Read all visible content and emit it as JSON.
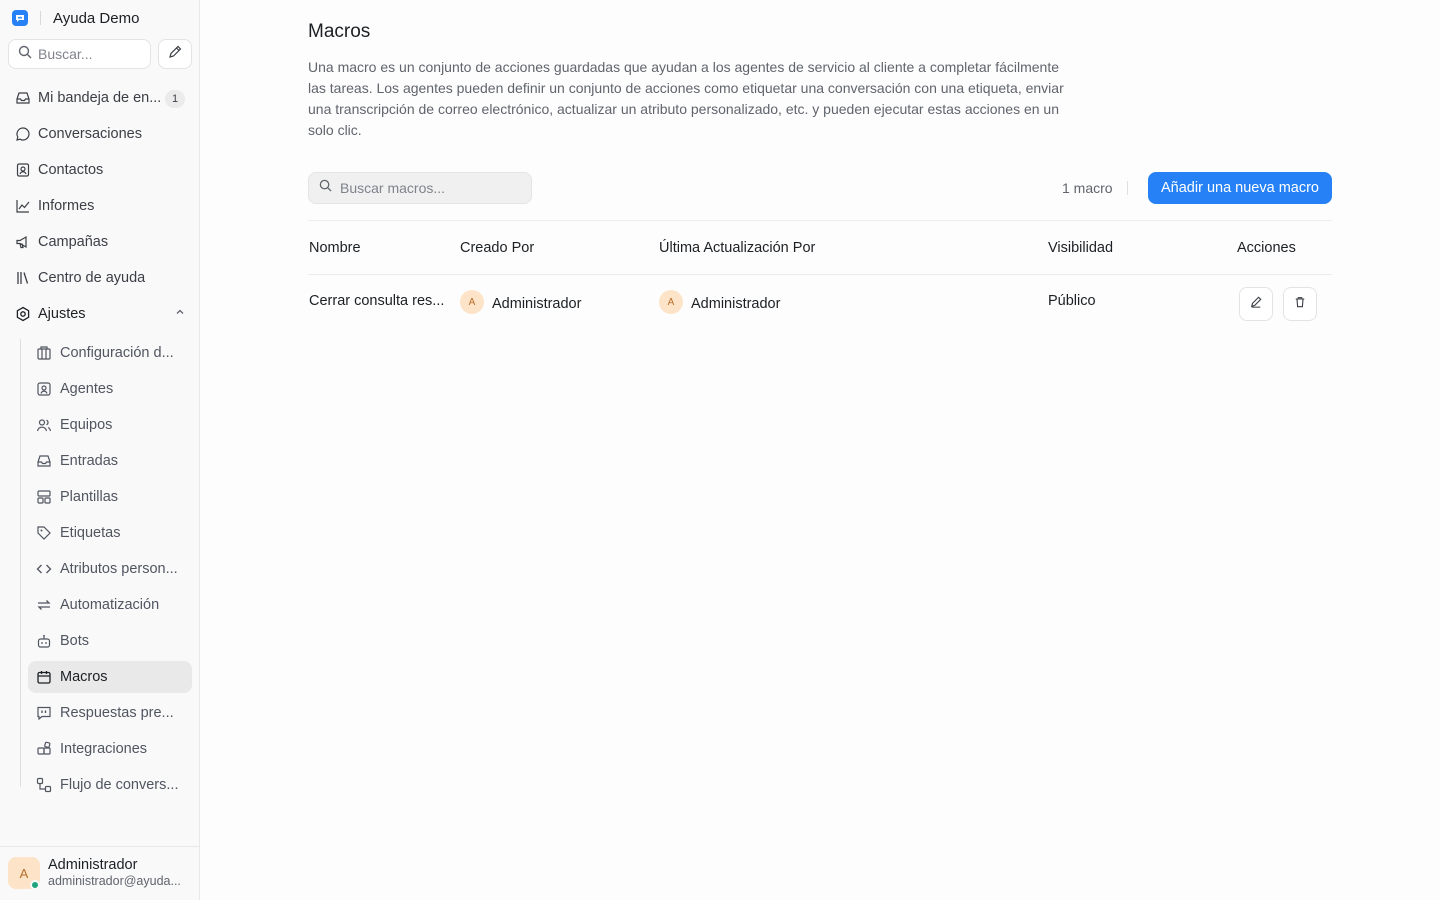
{
  "sidebar": {
    "brand": "Ayuda Demo",
    "search_placeholder": "Buscar...",
    "nav": [
      {
        "label": "Mi bandeja de en...",
        "icon": "inbox-icon",
        "badge": "1"
      },
      {
        "label": "Conversaciones",
        "icon": "chat-bubble-icon"
      },
      {
        "label": "Contactos",
        "icon": "contact-icon"
      },
      {
        "label": "Informes",
        "icon": "chart-line-icon"
      },
      {
        "label": "Campañas",
        "icon": "megaphone-icon"
      },
      {
        "label": "Centro de ayuda",
        "icon": "library-icon"
      },
      {
        "label": "Ajustes",
        "icon": "settings-icon"
      }
    ],
    "settings_items": [
      {
        "label": "Configuración d...",
        "icon": "building-icon"
      },
      {
        "label": "Agentes",
        "icon": "agent-icon"
      },
      {
        "label": "Equipos",
        "icon": "users-icon"
      },
      {
        "label": "Entradas",
        "icon": "inbox-icon"
      },
      {
        "label": "Plantillas",
        "icon": "template-icon"
      },
      {
        "label": "Etiquetas",
        "icon": "tag-icon"
      },
      {
        "label": "Atributos person...",
        "icon": "code-icon"
      },
      {
        "label": "Automatización",
        "icon": "automation-icon"
      },
      {
        "label": "Bots",
        "icon": "bot-icon"
      },
      {
        "label": "Macros",
        "icon": "macro-icon"
      },
      {
        "label": "Respuestas pre...",
        "icon": "quote-icon"
      },
      {
        "label": "Integraciones",
        "icon": "puzzle-icon"
      },
      {
        "label": "Flujo de convers...",
        "icon": "flow-icon"
      }
    ],
    "active_item": "Macros",
    "user": {
      "initial": "A",
      "name": "Administrador",
      "email": "administrador@ayuda..."
    }
  },
  "main": {
    "title": "Macros",
    "description": "Una macro es un conjunto de acciones guardadas que ayudan a los agentes de servicio al cliente a completar fácilmente las tareas. Los agentes pueden definir un conjunto de acciones como etiquetar una conversación con una etiqueta, enviar una transcripción de correo electrónico, actualizar un atributo personalizado, etc. y pueden ejecutar estas acciones en un solo clic.",
    "search_placeholder": "Buscar macros...",
    "count_label": "1 macro",
    "add_button": "Añadir una nueva macro",
    "table": {
      "headers": [
        "Nombre",
        "Creado Por",
        "Última Actualización Por",
        "Visibilidad",
        "Acciones"
      ],
      "rows": [
        {
          "name": "Cerrar consulta res...",
          "created_by": "Administrador",
          "created_by_initial": "A",
          "updated_by": "Administrador",
          "updated_by_initial": "A",
          "visibility": "Público"
        }
      ]
    }
  },
  "colors": {
    "accent": "#2781f6",
    "avatar_bg": "#fde3c7",
    "online": "#1fa37a"
  }
}
